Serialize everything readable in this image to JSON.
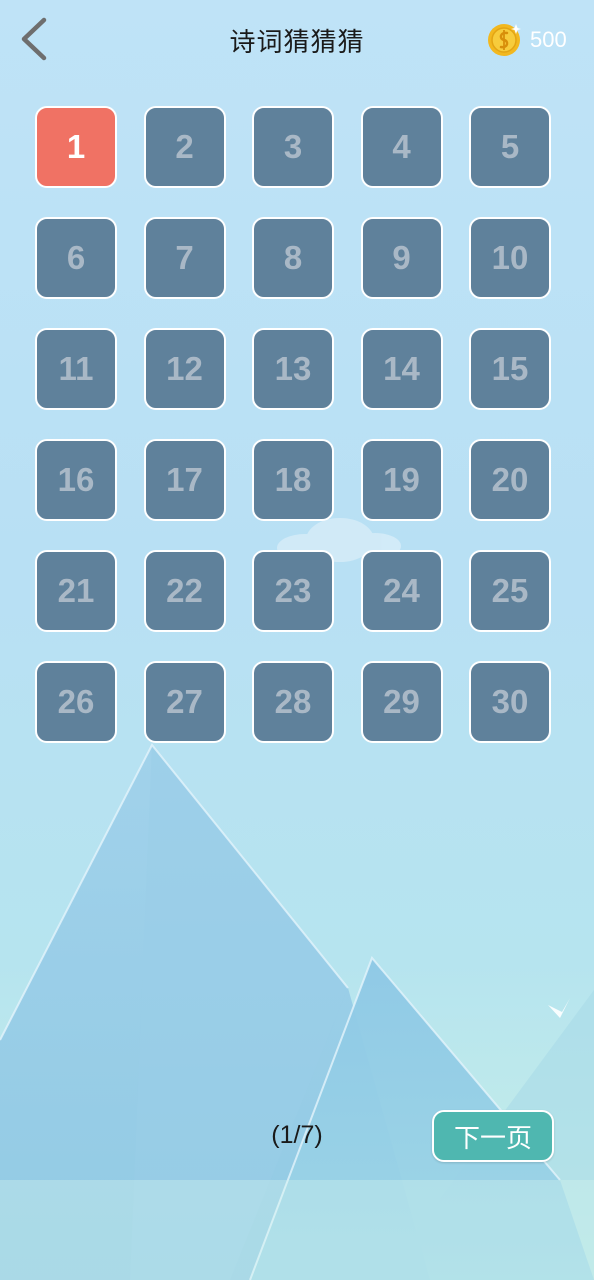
{
  "header": {
    "title": "诗词猜猜猜",
    "coins": "500",
    "back_icon": "chevron-left-icon",
    "coin_icon": "gold-coin-icon"
  },
  "levels": [
    {
      "label": "1",
      "state": "current"
    },
    {
      "label": "2",
      "state": "locked"
    },
    {
      "label": "3",
      "state": "locked"
    },
    {
      "label": "4",
      "state": "locked"
    },
    {
      "label": "5",
      "state": "locked"
    },
    {
      "label": "6",
      "state": "locked"
    },
    {
      "label": "7",
      "state": "locked"
    },
    {
      "label": "8",
      "state": "locked"
    },
    {
      "label": "9",
      "state": "locked"
    },
    {
      "label": "10",
      "state": "locked"
    },
    {
      "label": "11",
      "state": "locked"
    },
    {
      "label": "12",
      "state": "locked"
    },
    {
      "label": "13",
      "state": "locked"
    },
    {
      "label": "14",
      "state": "locked"
    },
    {
      "label": "15",
      "state": "locked"
    },
    {
      "label": "16",
      "state": "locked"
    },
    {
      "label": "17",
      "state": "locked"
    },
    {
      "label": "18",
      "state": "locked"
    },
    {
      "label": "19",
      "state": "locked"
    },
    {
      "label": "20",
      "state": "locked"
    },
    {
      "label": "21",
      "state": "locked"
    },
    {
      "label": "22",
      "state": "locked"
    },
    {
      "label": "23",
      "state": "locked"
    },
    {
      "label": "24",
      "state": "locked"
    },
    {
      "label": "25",
      "state": "locked"
    },
    {
      "label": "26",
      "state": "locked"
    },
    {
      "label": "27",
      "state": "locked"
    },
    {
      "label": "28",
      "state": "locked"
    },
    {
      "label": "29",
      "state": "locked"
    },
    {
      "label": "30",
      "state": "locked"
    }
  ],
  "pagination": {
    "indicator": "(1/7)",
    "next_label": "下一页"
  },
  "colors": {
    "current_level": "#f07264",
    "locked_level": "#5f819b",
    "next_button": "#4fb7b0"
  }
}
